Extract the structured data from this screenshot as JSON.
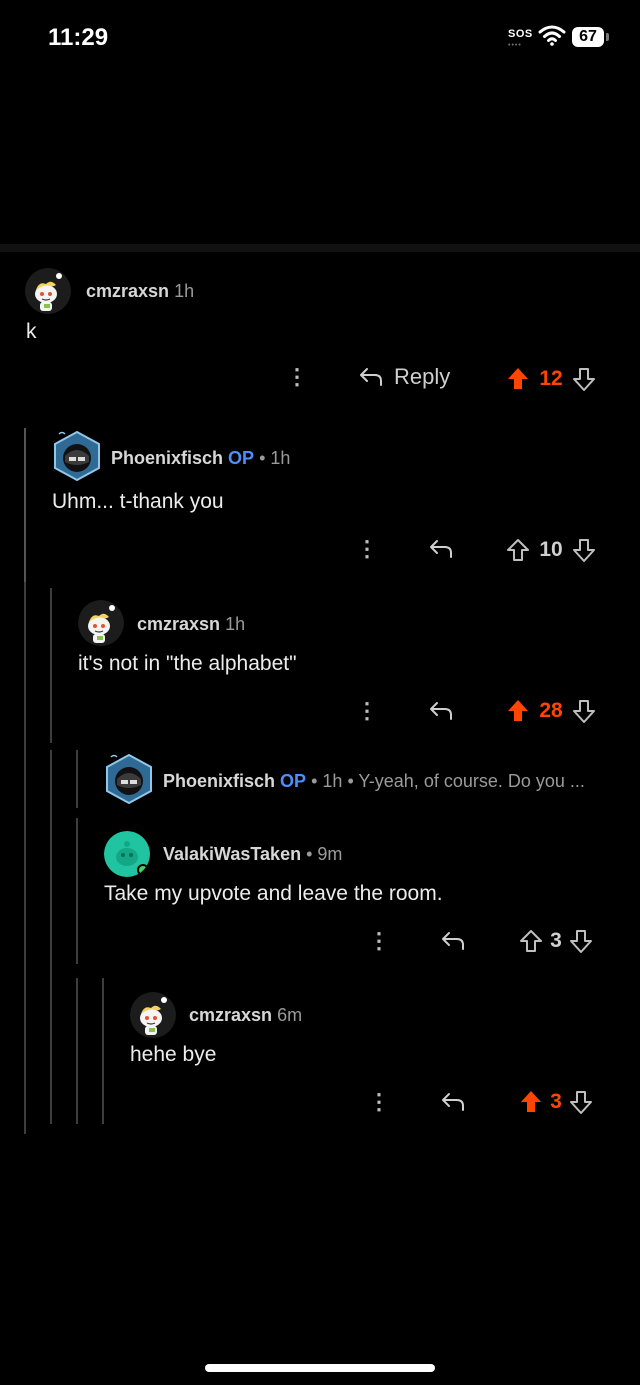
{
  "status_bar": {
    "time": "11:29",
    "sos": "SOS",
    "sos_dots": "••••",
    "battery": "67"
  },
  "comments": [
    {
      "user": "cmzraxsn",
      "op": "",
      "sep": "",
      "time": "1h",
      "preview": "",
      "body": "k",
      "reply_label": "Reply",
      "score": "12",
      "vote": "up",
      "avatar": "snoo"
    },
    {
      "user": "Phoenixfisch",
      "op": "OP",
      "sep": "•",
      "time": "1h",
      "preview": "",
      "body": "Uhm... t-thank you",
      "reply_label": "",
      "score": "10",
      "vote": "none",
      "avatar": "mask"
    },
    {
      "user": "cmzraxsn",
      "op": "",
      "sep": "",
      "time": "1h",
      "preview": "",
      "body": "it's not in \"the alphabet\"",
      "reply_label": "",
      "score": "28",
      "vote": "up",
      "avatar": "snoo"
    },
    {
      "user": "Phoenixfisch",
      "op": "OP",
      "sep": "•",
      "time": "1h",
      "preview": "• Y-yeah, of course. Do you ...",
      "body": "",
      "reply_label": "",
      "score": "",
      "vote": "",
      "avatar": "mask"
    },
    {
      "user": "ValakiWasTaken",
      "op": "",
      "sep": "•",
      "time": "9m",
      "preview": "",
      "body": "Take my upvote and leave the room.",
      "reply_label": "",
      "score": "3",
      "vote": "none",
      "avatar": "green"
    },
    {
      "user": "cmzraxsn",
      "op": "",
      "sep": "",
      "time": "6m",
      "preview": "",
      "body": "hehe bye",
      "reply_label": "",
      "score": "3",
      "vote": "up",
      "avatar": "snoo"
    }
  ],
  "colors": {
    "upvote": "#ff4500",
    "op": "#4f8ef7",
    "background": "#000000"
  },
  "icons": [
    "more-vertical-icon",
    "reply-arrow-icon",
    "upvote-arrow-icon",
    "downvote-arrow-icon",
    "wifi-icon"
  ]
}
